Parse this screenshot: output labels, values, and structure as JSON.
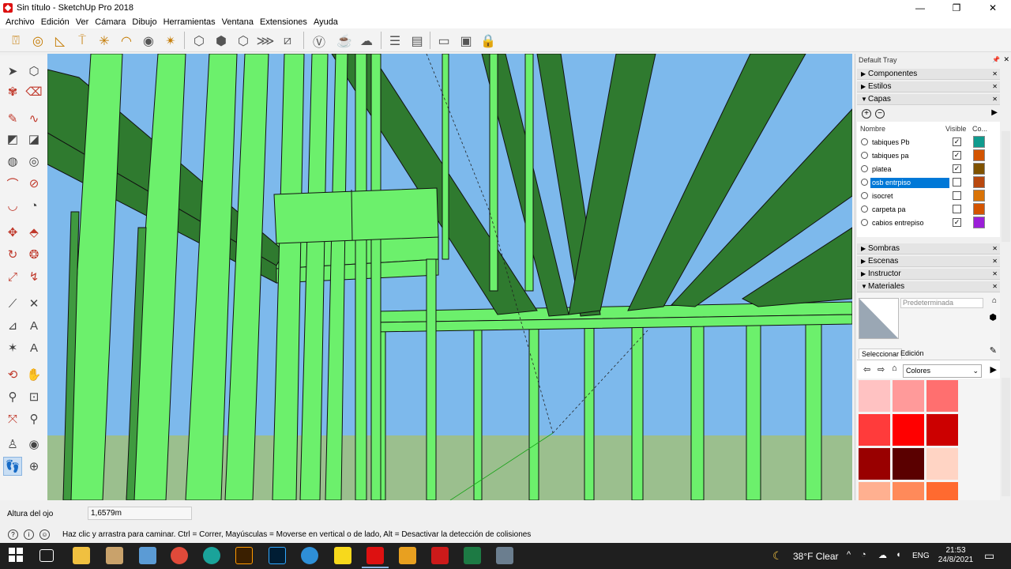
{
  "window": {
    "title": "Sin título - SketchUp Pro 2018",
    "controls": [
      "—",
      "❐",
      "✕"
    ]
  },
  "menu": [
    "Archivo",
    "Edición",
    "Ver",
    "Cámara",
    "Dibujo",
    "Herramientas",
    "Ventana",
    "Extensiones",
    "Ayuda"
  ],
  "toolbar_icons": [
    "select-icon",
    "orbit-icon",
    "protractor-icon",
    "tape-icon",
    "axes-icon",
    "sun-icon",
    "shadow-icon",
    "sandbox-icon",
    "cube-iso-icon",
    "cube-top-icon",
    "cube-front-icon",
    "cube-right-icon",
    "cube-back-icon",
    "cube-left-icon",
    "style-xray-icon",
    "teapot-icon",
    "teapot-gray-icon",
    "layer-tool-icon",
    "section-icon",
    "warehouse-icon",
    "extension-icon",
    "lock-icon"
  ],
  "tray": {
    "title": "Default Tray",
    "panels": {
      "componentes": "Componentes",
      "estilos": "Estilos",
      "capas": "Capas",
      "sombras": "Sombras",
      "escenas": "Escenas",
      "instructor": "Instructor",
      "materiales": "Materiales"
    },
    "layers": {
      "col_name": "Nombre",
      "col_visible": "Visible",
      "col_color": "Co...",
      "rows": [
        {
          "name": "tabiques Pb",
          "visible": true,
          "color": "#0f9b8e"
        },
        {
          "name": "tabiques pa",
          "visible": true,
          "color": "#d35400"
        },
        {
          "name": "platea",
          "visible": true,
          "color": "#7f5200"
        },
        {
          "name": "osb entrpiso",
          "visible": false,
          "color": "#b8480f",
          "active": true
        },
        {
          "name": "isocret",
          "visible": false,
          "color": "#d97306"
        },
        {
          "name": "carpeta pa",
          "visible": false,
          "color": "#d35400"
        },
        {
          "name": "cabios entrepiso",
          "visible": true,
          "color": "#9b1fd8"
        }
      ]
    },
    "materials": {
      "name": "Predeterminada",
      "tab_select": "Seleccionar",
      "tab_edit": "Edición",
      "library": "Colores",
      "swatches": [
        "#ffc2c2",
        "#ff9a9a",
        "#ff6f6f",
        "#ff3b3b",
        "#ff0000",
        "#cc0000",
        "#990000",
        "#5a0000",
        "#ffd4c4",
        "#ffb090",
        "#ff8a5a",
        "#ff6a30"
      ]
    }
  },
  "measurements": {
    "label": "Altura del ojo",
    "value": "1,6579m"
  },
  "status": {
    "message": "Haz clic y arrastra para caminar. Ctrl = Correr, Mayúsculas = Moverse en vertical o de lado, Alt = Desactivar la detección de colisiones"
  },
  "taskbar": {
    "weather": "38°F  Clear",
    "lang": "ENG",
    "time": "21:53",
    "date": "24/8/2021"
  },
  "colors": {
    "sky": "#7db9ec",
    "ground": "#9bbf8e",
    "beam_light": "#6cf06c",
    "beam_dark": "#2f7a2f",
    "accent": "#0078d7"
  }
}
